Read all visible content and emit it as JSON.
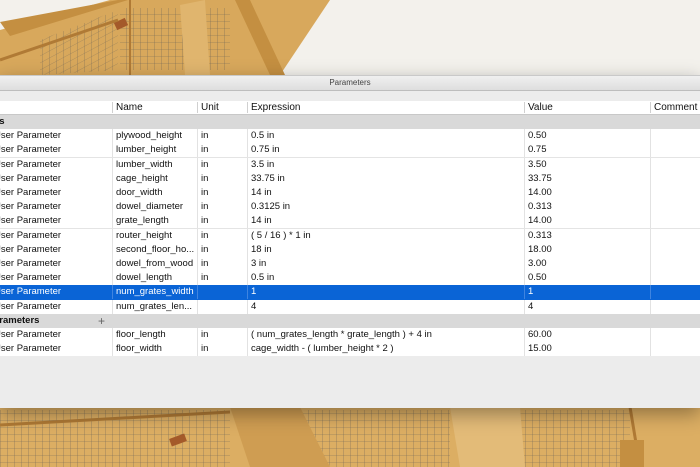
{
  "window": {
    "title": "Parameters"
  },
  "columns": {
    "type": "r",
    "name": "Name",
    "unit": "Unit",
    "expression": "Expression",
    "value": "Value",
    "comment": "Comment"
  },
  "groups": [
    {
      "label": "es"
    },
    {
      "label": "arameters"
    }
  ],
  "rows": [
    {
      "type": "User Parameter",
      "name": "plywood_height",
      "unit": "in",
      "expression": "0.5 in",
      "value": "0.50"
    },
    {
      "type": "User Parameter",
      "name": "lumber_height",
      "unit": "in",
      "expression": "0.75 in",
      "value": "0.75"
    },
    {
      "type": "User Parameter",
      "name": "lumber_width",
      "unit": "in",
      "expression": "3.5 in",
      "value": "3.50"
    },
    {
      "type": "User Parameter",
      "name": "cage_height",
      "unit": "in",
      "expression": "33.75 in",
      "value": "33.75"
    },
    {
      "type": "User Parameter",
      "name": "door_width",
      "unit": "in",
      "expression": "14 in",
      "value": "14.00"
    },
    {
      "type": "User Parameter",
      "name": "dowel_diameter",
      "unit": "in",
      "expression": "0.3125 in",
      "value": "0.313"
    },
    {
      "type": "User Parameter",
      "name": "grate_length",
      "unit": "in",
      "expression": "14 in",
      "value": "14.00"
    },
    {
      "type": "User Parameter",
      "name": "router_height",
      "unit": "in",
      "expression": "( 5 / 16 ) * 1 in",
      "value": "0.313"
    },
    {
      "type": "User Parameter",
      "name": "second_floor_ho...",
      "unit": "in",
      "expression": "18 in",
      "value": "18.00"
    },
    {
      "type": "User Parameter",
      "name": "dowel_from_wood",
      "unit": "in",
      "expression": "3 in",
      "value": "3.00"
    },
    {
      "type": "User Parameter",
      "name": "dowel_length",
      "unit": "in",
      "expression": "0.5 in",
      "value": "0.50"
    },
    {
      "type": "User Parameter",
      "name": "num_grates_width",
      "unit": "",
      "expression": "1",
      "value": "1",
      "selected": true
    },
    {
      "type": "User Parameter",
      "name": "num_grates_len...",
      "unit": "",
      "expression": "4",
      "value": "4"
    },
    {
      "type": "User Parameter",
      "name": "floor_length",
      "unit": "in",
      "expression": "( num_grates_length * grate_length ) + 4 in",
      "value": "60.00"
    },
    {
      "type": "User Parameter",
      "name": "floor_width",
      "unit": "in",
      "expression": "cage_width - ( lumber_height * 2 )",
      "value": "15.00"
    }
  ],
  "colors": {
    "selection": "#0a64d6",
    "group_bg": "#d9d9d9",
    "wood": "#d9a95a"
  },
  "icons": {
    "add": "plus-icon"
  }
}
